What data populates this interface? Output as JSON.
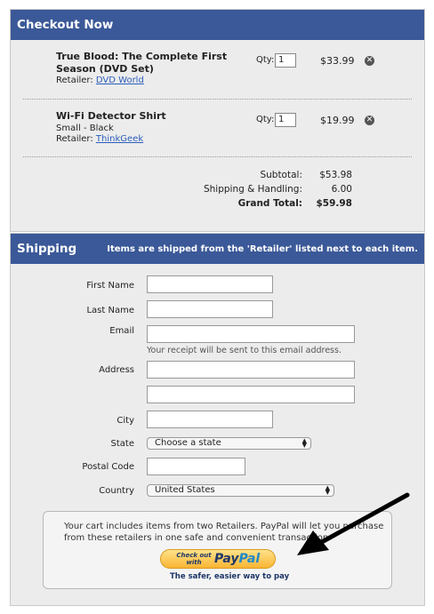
{
  "cart": {
    "title": "Checkout Now",
    "items": [
      {
        "name": "True Blood: The Complete First Season (DVD Set)",
        "variant": "",
        "retailer_label": "Retailer:",
        "retailer": "DVD World",
        "qty_label": "Qty:",
        "qty": "1",
        "price": "$33.99"
      },
      {
        "name": "Wi-Fi Detector Shirt",
        "variant": "Small - Black",
        "retailer_label": "Retailer:",
        "retailer": "ThinkGeek",
        "qty_label": "Qty:",
        "qty": "1",
        "price": "$19.99"
      }
    ],
    "totals": {
      "subtotal_label": "Subtotal:",
      "subtotal": "$53.98",
      "shipping_label": "Shipping & Handling:",
      "shipping": "6.00",
      "grand_label": "Grand Total:",
      "grand": "$59.98"
    },
    "remove_icon": "remove-circle-x-icon"
  },
  "shipping": {
    "title": "Shipping",
    "note": "Items are shipped from the 'Retailer' listed next to each item.",
    "labels": {
      "first_name": "First Name",
      "last_name": "Last Name",
      "email": "Email",
      "address": "Address",
      "city": "City",
      "state": "State",
      "postal": "Postal Code",
      "country": "Country"
    },
    "email_hint": "Your receipt will be sent to this email address.",
    "state_value": "Choose a state",
    "country_value": "United States"
  },
  "paypal": {
    "message": "Your cart includes items from two Retailers. PayPal will let you purchase from these retailers in one safe and convenient transaction.",
    "button_small": "Check out with",
    "button_logo_a": "Pay",
    "button_logo_b": "Pal",
    "tagline": "The safer, easier way to pay"
  },
  "colors": {
    "header_bar": "#3b5998",
    "panel_bg": "#ececec",
    "link": "#2c5dbb",
    "paypal_orange": "#f9b534"
  }
}
